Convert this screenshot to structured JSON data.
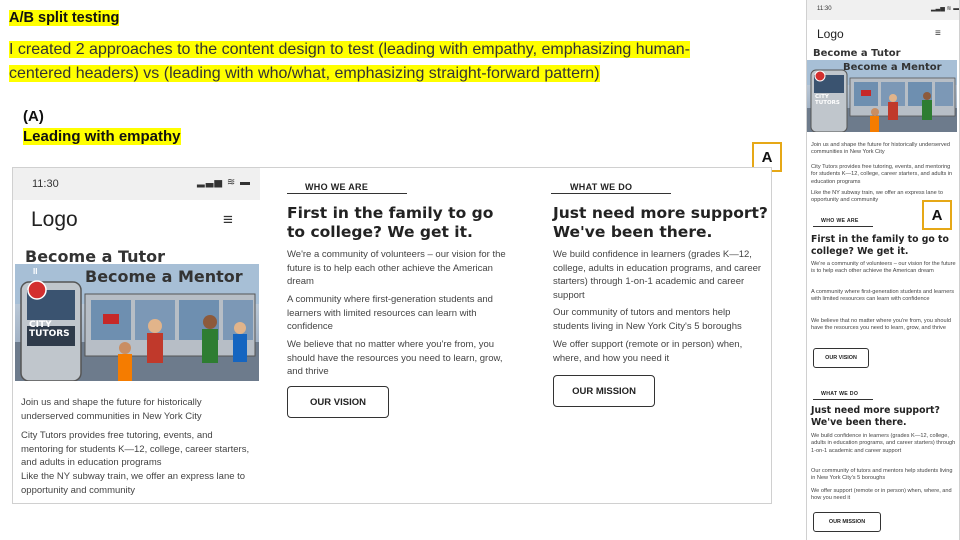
{
  "slide": {
    "title": "A/B split testing",
    "intro": "I created 2 approaches to the content design to test (leading with empathy, emphasizing human-centered headers) vs (leading with who/what, emphasizing straight-forward pattern)",
    "variant_letter": "(A)",
    "variant_name": "Leading with empathy",
    "badge_label": "A",
    "highlight_color": "#ffff00",
    "badge_color": "#e6a817"
  },
  "phone": {
    "time": "11:30",
    "status_icons": "signal-wifi-battery-icons",
    "status_glyphs": "▂▃▅ ≋ ▬",
    "logo": "Logo",
    "menu_icon": "hamburger-menu-icon",
    "menu_glyph": "≡",
    "hero_line1": "Become a Tutor",
    "hero_line2": "Become a Mentor",
    "hero_sign": "CITY TUTORS",
    "hero_emblem": "II",
    "intro": [
      "Join us and shape the future for historically underserved communities in New York City",
      "City Tutors provides free tutoring, events, and mentoring for students K—12, college, career starters, and adults in education programs",
      "Like the NY subway train, we offer an express lane to opportunity and community"
    ]
  },
  "who": {
    "eyebrow": "WHO WE ARE",
    "heading": "First in the family to go to college? We get it.",
    "paragraphs": [
      "We're a community of volunteers – our vision for the future is to help each other achieve the American dream",
      "A community where first-generation students and learners with limited resources can learn with confidence",
      "We believe that no matter where you're from, you should have the resources you need to learn, grow, and thrive"
    ],
    "button": "OUR VISION"
  },
  "what": {
    "eyebrow": "WHAT WE DO",
    "heading": "Just need more support? We've been there.",
    "paragraphs": [
      "We build confidence in learners (grades K—12, college, adults in education programs, and career starters) through 1-on-1 academic and career support",
      "Our community of tutors and mentors help students living in New York City's 5 boroughs",
      "We offer support (remote or in person) when, where, and how you need it"
    ],
    "button": "OUR MISSION"
  }
}
